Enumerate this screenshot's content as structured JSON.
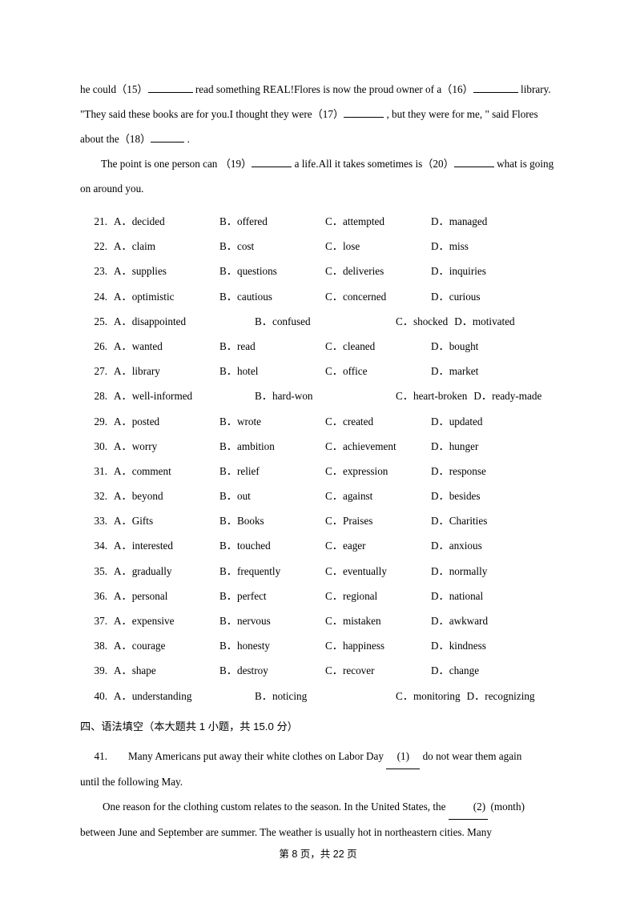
{
  "passage": {
    "line1_pre": "he could（15）",
    "line1_mid": "read something REAL!Flores is now the proud owner of a（16）",
    "line1_end": "library.",
    "line2_pre": "\"They said these books are for you.I thought they were（17）",
    "line2_mid": ", but they were for me, \" said Flores",
    "line3_pre": "about the（18）",
    "line3_end": ".",
    "line4_pre": "The point is one person can （19）",
    "line4_mid": "a life.All it takes sometimes is（20）",
    "line4_end": "what is going",
    "line5": "on around you."
  },
  "questions": [
    {
      "num": "21.",
      "a": "A．decided",
      "b": "B．offered",
      "c": "C．attempted",
      "d": "D．managed",
      "wide": false
    },
    {
      "num": "22.",
      "a": "A．claim",
      "b": "B．cost",
      "c": "C．lose",
      "d": "D．miss",
      "wide": false
    },
    {
      "num": "23.",
      "a": "A．supplies",
      "b": "B．questions",
      "c": "C．deliveries",
      "d": "D．inquiries",
      "wide": false
    },
    {
      "num": "24.",
      "a": "A．optimistic",
      "b": "B．cautious",
      "c": "C．concerned",
      "d": "D．curious",
      "wide": false
    },
    {
      "num": "25.",
      "a": "A．disappointed",
      "b": "B．confused",
      "c": "C．shocked",
      "d": "D．motivated",
      "wide": true
    },
    {
      "num": "26.",
      "a": "A．wanted",
      "b": "B．read",
      "c": "C．cleaned",
      "d": "D．bought",
      "wide": false
    },
    {
      "num": "27.",
      "a": "A．library",
      "b": "B．hotel",
      "c": "C．office",
      "d": "D．market",
      "wide": false
    },
    {
      "num": "28.",
      "a": "A．well-informed",
      "b": "B．hard-won",
      "c": "C．heart-broken",
      "d": "D．ready-made",
      "wide": true
    },
    {
      "num": "29.",
      "a": "A．posted",
      "b": "B．wrote",
      "c": "C．created",
      "d": "D．updated",
      "wide": false
    },
    {
      "num": "30.",
      "a": "A．worry",
      "b": "B．ambition",
      "c": "C．achievement",
      "d": "D．hunger",
      "wide": false
    },
    {
      "num": "31.",
      "a": "A．comment",
      "b": "B．relief",
      "c": "C．expression",
      "d": "D．response",
      "wide": false
    },
    {
      "num": "32.",
      "a": "A．beyond",
      "b": "B．out",
      "c": "C．against",
      "d": "D．besides",
      "wide": false
    },
    {
      "num": "33.",
      "a": "A．Gifts",
      "b": "B．Books",
      "c": "C．Praises",
      "d": "D．Charities",
      "wide": false
    },
    {
      "num": "34.",
      "a": "A．interested",
      "b": "B．touched",
      "c": "C．eager",
      "d": "D．anxious",
      "wide": false
    },
    {
      "num": "35.",
      "a": "A．gradually",
      "b": "B．frequently",
      "c": "C．eventually",
      "d": "D．normally",
      "wide": false
    },
    {
      "num": "36.",
      "a": "A．personal",
      "b": "B．perfect",
      "c": "C．regional",
      "d": "D．national",
      "wide": false
    },
    {
      "num": "37.",
      "a": "A．expensive",
      "b": "B．nervous",
      "c": "C．mistaken",
      "d": "D．awkward",
      "wide": false
    },
    {
      "num": "38.",
      "a": "A．courage",
      "b": "B．honesty",
      "c": "C．happiness",
      "d": "D．kindness",
      "wide": false
    },
    {
      "num": "39.",
      "a": "A．shape",
      "b": "B．destroy",
      "c": "C．recover",
      "d": "D．change",
      "wide": false
    },
    {
      "num": "40.",
      "a": "A．understanding",
      "b": "B．noticing",
      "c": "C．monitoring",
      "d": "D．recognizing",
      "wide": true
    }
  ],
  "section": {
    "heading": "四、语法填空（本大题共 1 小题，共 15.0 分）"
  },
  "grammar": {
    "num": "41.",
    "line1_pre": "Many Americans put away their white clothes on Labor Day",
    "blank1": "(1)",
    "line1_post": "do not wear them again",
    "line2": "until the following May.",
    "line3_pre": "One reason for the clothing custom relates to the season. In the United States, the",
    "blank2": "(2)",
    "line3_post": "(month)",
    "line4": "between June and September are summer. The weather is usually hot in northeastern cities. Many"
  },
  "footer": {
    "text": "第 8 页，共 22 页"
  }
}
